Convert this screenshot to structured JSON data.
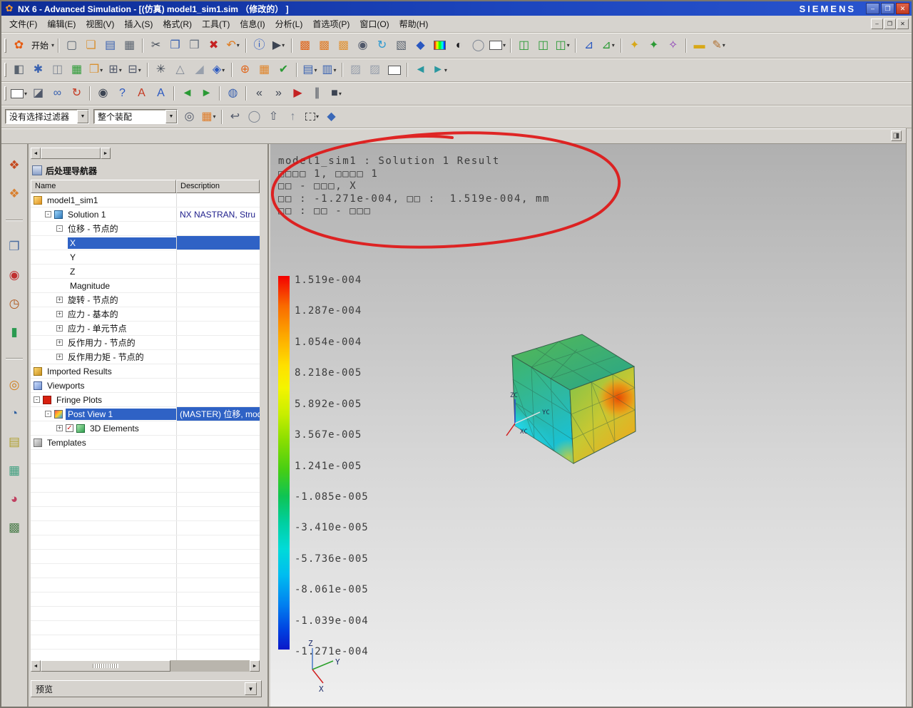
{
  "window": {
    "title": "NX 6 - Advanced Simulation - [(仿真) model1_sim1.sim （修改的） ]",
    "brand": "SIEMENS"
  },
  "glyphs": {
    "app": "✿",
    "min": "–",
    "restore": "❐",
    "close": "✕",
    "down": "▼",
    "drop": "▾",
    "left": "◄",
    "right": "►",
    "check": "✓",
    "panel": "◨"
  },
  "menu": {
    "items": [
      "文件(F)",
      "编辑(E)",
      "视图(V)",
      "插入(S)",
      "格式(R)",
      "工具(T)",
      "信息(I)",
      "分析(L)",
      "首选项(P)",
      "窗口(O)",
      "帮助(H)"
    ]
  },
  "selection": {
    "filter": "没有选择过滤器",
    "scope": "整个装配"
  },
  "toolbars": {
    "row1": [
      {
        "n": "nx-logo-icon",
        "g": "✿",
        "c": "#e65c12"
      },
      {
        "n": "start-button",
        "text": "开始",
        "d": 1
      },
      {
        "sep": 1
      },
      {
        "n": "new-file-icon",
        "g": "▢",
        "c": "#55606e"
      },
      {
        "n": "open-icon",
        "g": "❏",
        "c": "#d89030"
      },
      {
        "n": "save-icon",
        "g": "▤",
        "c": "#3a62b0"
      },
      {
        "n": "print-icon",
        "g": "▦",
        "c": "#5a6470"
      },
      {
        "sep": 1
      },
      {
        "n": "cut-icon",
        "g": "✂",
        "c": "#444c58"
      },
      {
        "n": "copy-icon",
        "g": "❐",
        "c": "#3a62b0"
      },
      {
        "n": "paste-icon",
        "g": "❒",
        "c": "#6a7480"
      },
      {
        "n": "delete-icon",
        "g": "✖",
        "c": "#c42222"
      },
      {
        "n": "undo-icon",
        "g": "↶",
        "c": "#e07818",
        "d": 1
      },
      {
        "sep": 1
      },
      {
        "n": "info-icon",
        "g": "ⓘ",
        "c": "#2a58c0"
      },
      {
        "n": "command-finder-icon",
        "g": "▶",
        "c": "#3c4452",
        "d": 1
      },
      {
        "sep": 1
      },
      {
        "n": "display-window-icon",
        "g": "▩",
        "c": "#e06418"
      },
      {
        "n": "display-window2-icon",
        "g": "▩",
        "c": "#e07c28"
      },
      {
        "n": "display-window3-icon",
        "g": "▩",
        "c": "#e09438"
      },
      {
        "n": "zoom-icon",
        "g": "◉",
        "c": "#50586a"
      },
      {
        "n": "rotate-view-icon",
        "g": "↻",
        "c": "#2a98d0"
      },
      {
        "n": "pan-icon",
        "g": "▧",
        "c": "#5a6470"
      },
      {
        "n": "fit-view-icon",
        "g": "◆",
        "c": "#2a58c0"
      },
      {
        "n": "rainbow-icon",
        "rainbow": 1
      },
      {
        "n": "shaded-display-icon",
        "g": "◐",
        "c": "#18181c"
      },
      {
        "n": "wireframe-display-icon",
        "g": "◯",
        "c": "#808894"
      },
      {
        "n": "background-swatch",
        "swatch": 1,
        "d": 1
      },
      {
        "sep": 1
      },
      {
        "n": "export-view1-icon",
        "g": "◫",
        "c": "#2a9a34"
      },
      {
        "n": "export-view2-icon",
        "g": "◫",
        "c": "#2a9a34"
      },
      {
        "n": "export-view3-icon",
        "g": "◫",
        "c": "#2a9a34",
        "d": 1
      },
      {
        "sep": 1
      },
      {
        "n": "graph-icon",
        "g": "⊿",
        "c": "#2a58c0"
      },
      {
        "n": "graph2-icon",
        "g": "⊿",
        "c": "#2a9a34",
        "d": 1
      },
      {
        "sep": 1
      },
      {
        "n": "effect1-icon",
        "g": "✦",
        "c": "#d8a818"
      },
      {
        "n": "effect2-icon",
        "g": "✦",
        "c": "#2a9a34"
      },
      {
        "n": "effect3-icon",
        "g": "✧",
        "c": "#8a3ab8"
      },
      {
        "sep": 1
      },
      {
        "n": "measure-icon",
        "g": "▬",
        "c": "#d8a818"
      },
      {
        "n": "annotate-icon",
        "g": "✎",
        "c": "#b07030",
        "d": 1
      }
    ],
    "row2": [
      {
        "n": "assembly-icon",
        "g": "◧",
        "c": "#5a6470"
      },
      {
        "n": "gear-icon",
        "g": "✱",
        "c": "#3a62b0"
      },
      {
        "n": "component-icon",
        "g": "◫",
        "c": "#808894"
      },
      {
        "n": "table-icon",
        "g": "▦",
        "c": "#2a9a34"
      },
      {
        "n": "clipboard-icon",
        "g": "❒",
        "c": "#d89030",
        "d": 1
      },
      {
        "n": "add-icon",
        "g": "⊞",
        "c": "#50586a",
        "d": 1
      },
      {
        "n": "remove-icon",
        "g": "⊟",
        "c": "#50586a",
        "d": 1
      },
      {
        "sep": 1
      },
      {
        "n": "pattern-icon",
        "g": "✳",
        "c": "#444c58"
      },
      {
        "n": "triangle-icon",
        "g": "△",
        "c": "#808894"
      },
      {
        "n": "wedge-icon",
        "g": "◢",
        "c": "#98a0ac"
      },
      {
        "n": "diamond-icon",
        "g": "◈",
        "c": "#2a58c0",
        "d": 1
      },
      {
        "sep": 1
      },
      {
        "n": "target-icon",
        "g": "⊕",
        "c": "#e06418"
      },
      {
        "n": "mesh-icon",
        "g": "▦",
        "c": "#e08428"
      },
      {
        "n": "check-icon",
        "g": "✔",
        "c": "#2a9a34"
      },
      {
        "sep": 1
      },
      {
        "n": "list-icon",
        "g": "▤",
        "c": "#3a62b0",
        "d": 1
      },
      {
        "n": "list2-icon",
        "g": "▥",
        "c": "#3a62b0",
        "d": 1
      },
      {
        "sep": 1
      },
      {
        "n": "image1-icon",
        "g": "▨",
        "c": "#98a0ac"
      },
      {
        "n": "image2-icon",
        "g": "▨",
        "c": "#98a0ac"
      },
      {
        "n": "blank-swatch",
        "swatch": 1
      },
      {
        "sep": 1
      },
      {
        "n": "back-icon",
        "g": "◄",
        "c": "#2a98a0"
      },
      {
        "n": "forward-icon",
        "g": "►",
        "c": "#2a98a0",
        "d": 1
      }
    ],
    "row3": [
      {
        "n": "material-swatch",
        "swatch": 1,
        "d": 1
      },
      {
        "n": "shade-icon",
        "g": "◪",
        "c": "#50586a"
      },
      {
        "n": "link-icon",
        "g": "∞",
        "c": "#3a62b0"
      },
      {
        "n": "reload-icon",
        "g": "↻",
        "c": "#c43a22"
      },
      {
        "sep": 1
      },
      {
        "n": "camera-icon",
        "g": "◉",
        "c": "#3c4452"
      },
      {
        "n": "help-icon",
        "g": "?",
        "c": "#2a58c0"
      },
      {
        "n": "text-style-icon",
        "g": "A",
        "c": "#c43a22"
      },
      {
        "n": "text-style2-icon",
        "g": "A",
        "c": "#2a58c0"
      },
      {
        "sep": 1
      },
      {
        "n": "prev-icon",
        "g": "◄",
        "c": "#2a9a34"
      },
      {
        "n": "next-icon",
        "g": "►",
        "c": "#2a9a34"
      },
      {
        "sep": 1
      },
      {
        "n": "navigate-icon",
        "g": "◍",
        "c": "#3a62b0"
      },
      {
        "sep": 1
      },
      {
        "n": "first-frame-icon",
        "g": "«",
        "c": "#3c4452"
      },
      {
        "n": "last-frame-icon",
        "g": "»",
        "c": "#3c4452"
      },
      {
        "n": "play-icon",
        "g": "▶",
        "c": "#c42222"
      },
      {
        "n": "pause-icon",
        "g": "∥",
        "c": "#3c4452"
      },
      {
        "n": "stop-icon",
        "g": "■",
        "c": "#3c4452",
        "d": 1
      }
    ],
    "selection_icons": [
      {
        "n": "snap-icon",
        "g": "◎",
        "c": "#50586a"
      },
      {
        "n": "mesh-grid-icon",
        "g": "▦",
        "c": "#e07c28",
        "d": 1
      },
      {
        "sep": 1
      },
      {
        "n": "undo-small-icon",
        "g": "↩",
        "c": "#50586a"
      },
      {
        "n": "sphere-icon",
        "g": "◯",
        "c": "#808894"
      },
      {
        "n": "up-icon",
        "g": "⇧",
        "c": "#50586a"
      },
      {
        "n": "up2-icon",
        "g": "↑",
        "c": "#808894"
      },
      {
        "n": "select-box-icon",
        "dash": 1,
        "d": 1
      },
      {
        "n": "solid-cube-icon",
        "g": "◆",
        "c": "#3a68b8"
      }
    ]
  },
  "resource_bar": {
    "icons": [
      {
        "n": "navigator1-icon",
        "g": "❖",
        "c": "#c44a20"
      },
      {
        "n": "navigator2-icon",
        "g": "❖",
        "c": "#d88030"
      },
      {
        "sep": 1
      },
      {
        "n": "assembly-nav-icon",
        "g": "❐",
        "c": "#4a6da0"
      },
      {
        "n": "constraint-nav-icon",
        "g": "◉",
        "c": "#c03030"
      },
      {
        "n": "history-icon",
        "g": "◷",
        "c": "#b05a20"
      },
      {
        "n": "simulation-nav-icon",
        "g": "▮",
        "c": "#2a9a50"
      },
      {
        "sep": 1
      },
      {
        "n": "web-browser-icon",
        "g": "◎",
        "c": "#d08020"
      },
      {
        "n": "clock-icon",
        "g": "◔",
        "c": "#3060a0"
      },
      {
        "n": "notes-icon",
        "g": "▤",
        "c": "#b0a030"
      },
      {
        "n": "chart-icon",
        "g": "▦",
        "c": "#40a080"
      },
      {
        "n": "roles-icon",
        "g": "◕",
        "c": "#c04060"
      },
      {
        "n": "image-icon",
        "g": "▩",
        "c": "#508050"
      }
    ]
  },
  "navigator": {
    "title": "后处理导航器",
    "columns": [
      "Name",
      "Description"
    ],
    "preview_label": "预览",
    "rows": [
      {
        "label": "model1_sim1",
        "desc": "",
        "lvl": 0,
        "icon": "part"
      },
      {
        "label": "Solution 1",
        "desc": "NX NASTRAN, Stru",
        "lvl": 1,
        "exp": "-",
        "icon": "sol",
        "desc_navy": true
      },
      {
        "label": "位移 - 节点的",
        "desc": "",
        "lvl": 2,
        "exp": "-"
      },
      {
        "label": "X",
        "desc": "",
        "lvl": 3,
        "sel": true
      },
      {
        "label": "Y",
        "desc": "",
        "lvl": 3
      },
      {
        "label": "Z",
        "desc": "",
        "lvl": 3
      },
      {
        "label": "Magnitude",
        "desc": "",
        "lvl": 3
      },
      {
        "label": "旋转 - 节点的",
        "desc": "",
        "lvl": 2,
        "exp": "+"
      },
      {
        "label": "应力 - 基本的",
        "desc": "",
        "lvl": 2,
        "exp": "+"
      },
      {
        "label": "应力 - 单元节点",
        "desc": "",
        "lvl": 2,
        "exp": "+"
      },
      {
        "label": "反作用力 - 节点的",
        "desc": "",
        "lvl": 2,
        "exp": "+"
      },
      {
        "label": "反作用力矩 - 节点的",
        "desc": "",
        "lvl": 2,
        "exp": "+"
      },
      {
        "label": "Imported Results",
        "desc": "",
        "lvl": 0,
        "icon": "imported"
      },
      {
        "label": "Viewports",
        "desc": "",
        "lvl": 0,
        "icon": "viewports"
      },
      {
        "label": "Fringe Plots",
        "desc": "",
        "lvl": 0,
        "exp": "-",
        "icon": "fringe"
      },
      {
        "label": "Post View 1",
        "desc": "(MASTER) 位移, mod",
        "lvl": 1,
        "exp": "-",
        "icon": "postview",
        "sel": true
      },
      {
        "label": "3D Elements",
        "desc": "",
        "lvl": 2,
        "exp": "+",
        "check": true,
        "icon": "elements"
      },
      {
        "label": "Templates",
        "desc": "",
        "lvl": 0,
        "icon": "templates"
      }
    ]
  },
  "viewport": {
    "header_lines": [
      "model1_sim1 : Solution 1 Result",
      "□□□□ 1, □□□□ 1",
      "□□ - □□□, X",
      "□□ : -1.271e-004, □□ :  1.519e-004, mm",
      "□□ : □□ - □□□"
    ],
    "legend_values": [
      "1.519e-004",
      "1.287e-004",
      "1.054e-004",
      "8.218e-005",
      "5.892e-005",
      "3.567e-005",
      "1.241e-005",
      "-1.085e-005",
      "-3.410e-005",
      "-5.736e-005",
      "-8.061e-005",
      "-1.039e-004",
      "-1.271e-004"
    ],
    "triad": {
      "zc": "ZC",
      "yc": "YC",
      "xc": "XC"
    },
    "wcs": {
      "x": "X",
      "y": "Y",
      "z": "Z"
    }
  }
}
